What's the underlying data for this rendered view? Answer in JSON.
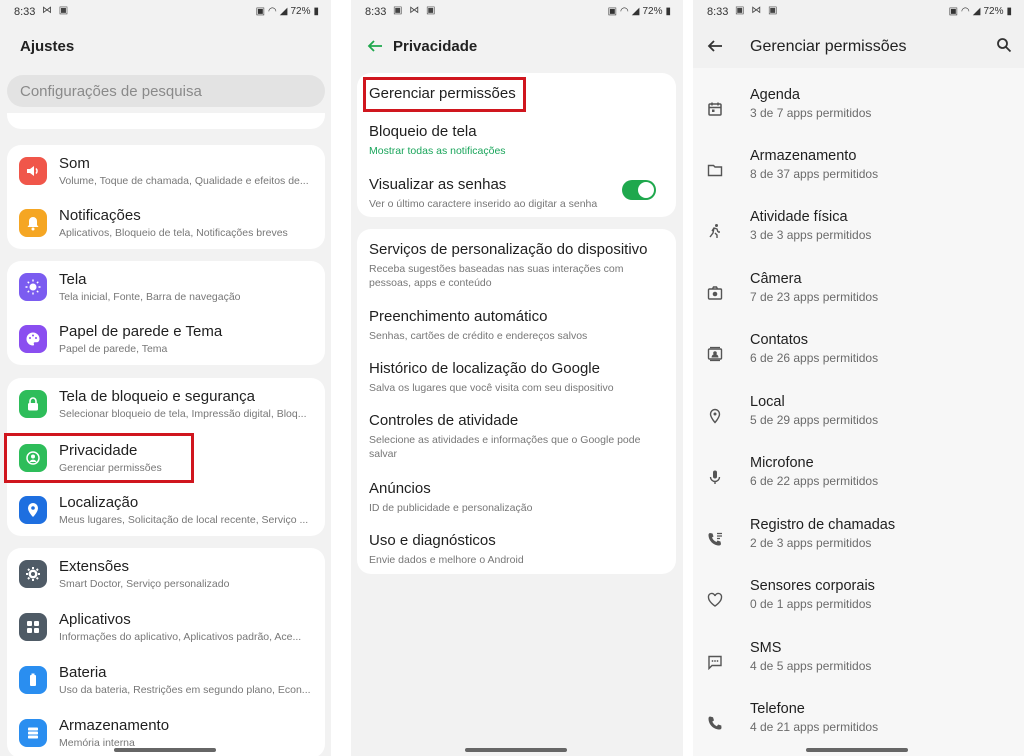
{
  "status": {
    "time": "8:33",
    "battery": "72%"
  },
  "settings": {
    "title": "Ajustes",
    "search_placeholder": "Configurações de pesquisa",
    "items": [
      {
        "title": "Som",
        "sub": "Volume, Toque de chamada, Qualidade e efeitos de...",
        "icon": "speaker-icon",
        "color": "#f0564a"
      },
      {
        "title": "Notificações",
        "sub": "Aplicativos, Bloqueio de tela, Notificações breves",
        "icon": "bell-icon",
        "color": "#f5a623"
      },
      {
        "title": "Tela",
        "sub": "Tela inicial, Fonte, Barra de navegação",
        "icon": "sun-icon",
        "color": "#7b5cf0"
      },
      {
        "title": "Papel de parede e Tema",
        "sub": "Papel de parede, Tema",
        "icon": "palette-icon",
        "color": "#8a4ef0"
      },
      {
        "title": "Tela de bloqueio e segurança",
        "sub": "Selecionar bloqueio de tela, Impressão digital, Bloq...",
        "icon": "lock-icon",
        "color": "#2ebd5a"
      },
      {
        "title": "Privacidade",
        "sub": "Gerenciar permissões",
        "icon": "privacy-icon",
        "color": "#2ebd5a"
      },
      {
        "title": "Localização",
        "sub": "Meus lugares, Solicitação de local recente, Serviço ...",
        "icon": "location-pin-icon",
        "color": "#1e6fe0"
      },
      {
        "title": "Extensões",
        "sub": "Smart Doctor, Serviço personalizado",
        "icon": "gear-icon",
        "color": "#4f5b66"
      },
      {
        "title": "Aplicativos",
        "sub": "Informações do aplicativo, Aplicativos padrão, Ace...",
        "icon": "apps-grid-icon",
        "color": "#4f5b66"
      },
      {
        "title": "Bateria",
        "sub": "Uso da bateria, Restrições em segundo plano, Econ...",
        "icon": "battery-icon",
        "color": "#2a8ef0"
      },
      {
        "title": "Armazenamento",
        "sub": "Memória interna",
        "icon": "storage-icon",
        "color": "#2a8ef0"
      }
    ]
  },
  "privacy": {
    "title": "Privacidade",
    "items": [
      {
        "title": "Gerenciar permissões",
        "sub": ""
      },
      {
        "title": "Bloqueio de tela",
        "sub": "Mostrar todas as notificações"
      },
      {
        "title": "Visualizar as senhas",
        "sub": "Ver o último caractere inserido ao digitar a senha"
      },
      {
        "title": "Serviços de personalização do dispositivo",
        "sub": "Receba sugestões baseadas nas suas interações com pessoas, apps e conteúdo"
      },
      {
        "title": "Preenchimento automático",
        "sub": "Senhas, cartões de crédito e endereços salvos"
      },
      {
        "title": "Histórico de localização do Google",
        "sub": "Salva os lugares que você visita com seu dispositivo"
      },
      {
        "title": "Controles de atividade",
        "sub": "Selecione as atividades e informações que o Google pode salvar"
      },
      {
        "title": "Anúncios",
        "sub": "ID de publicidade e personalização"
      },
      {
        "title": "Uso e diagnósticos",
        "sub": "Envie dados e melhore o Android"
      }
    ]
  },
  "permissions": {
    "title": "Gerenciar permissões",
    "items": [
      {
        "title": "Agenda",
        "sub": "3 de 7 apps permitidos",
        "icon": "calendar-icon"
      },
      {
        "title": "Armazenamento",
        "sub": "8 de 37 apps permitidos",
        "icon": "folder-icon"
      },
      {
        "title": "Atividade física",
        "sub": "3 de 3 apps permitidos",
        "icon": "running-icon"
      },
      {
        "title": "Câmera",
        "sub": "7 de 23 apps permitidos",
        "icon": "camera-icon"
      },
      {
        "title": "Contatos",
        "sub": "6 de 26 apps permitidos",
        "icon": "contacts-icon"
      },
      {
        "title": "Local",
        "sub": "5 de 29 apps permitidos",
        "icon": "location-pin-icon"
      },
      {
        "title": "Microfone",
        "sub": "6 de 22 apps permitidos",
        "icon": "microphone-icon"
      },
      {
        "title": "Registro de chamadas",
        "sub": "2 de 3 apps permitidos",
        "icon": "call-log-icon"
      },
      {
        "title": "Sensores corporais",
        "sub": "0 de 1 apps permitidos",
        "icon": "heart-icon"
      },
      {
        "title": "SMS",
        "sub": "4 de 5 apps permitidos",
        "icon": "sms-icon"
      },
      {
        "title": "Telefone",
        "sub": "4 de 21 apps permitidos",
        "icon": "phone-icon"
      }
    ]
  }
}
